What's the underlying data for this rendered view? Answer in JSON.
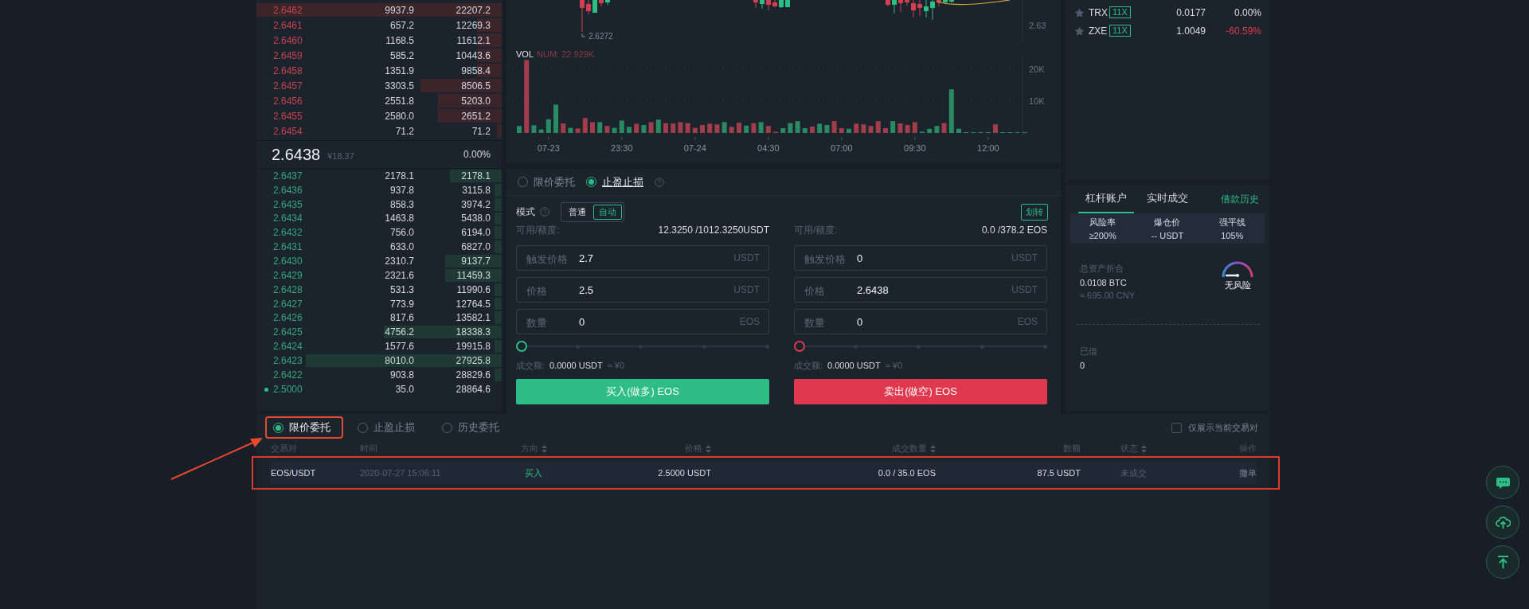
{
  "order_book": {
    "asks": [
      {
        "price": "2.6462",
        "amount": "9937.9",
        "total": "22207.2",
        "level": 1.0
      },
      {
        "price": "2.6461",
        "amount": "657.2",
        "total": "12269.3",
        "level": 0.1
      },
      {
        "price": "2.6460",
        "amount": "1168.5",
        "total": "11612.1",
        "level": 0.1
      },
      {
        "price": "2.6459",
        "amount": "585.2",
        "total": "10443.6",
        "level": 0.1
      },
      {
        "price": "2.6458",
        "amount": "1351.9",
        "total": "9858.4",
        "level": 0.1
      },
      {
        "price": "2.6457",
        "amount": "3303.5",
        "total": "8506.5",
        "level": 0.33
      },
      {
        "price": "2.6456",
        "amount": "2551.8",
        "total": "5203.0",
        "level": 0.26
      },
      {
        "price": "2.6455",
        "amount": "2580.0",
        "total": "2651.2",
        "level": 0.26
      },
      {
        "price": "2.6454",
        "amount": "71.2",
        "total": "71.2",
        "level": 0.02
      }
    ],
    "last": {
      "price": "2.6438",
      "cny": "¥18.37",
      "change": "0.00%"
    },
    "bids": [
      {
        "price": "2.6437",
        "amount": "2178.1",
        "total": "2178.1",
        "level": 0.21,
        "own_order": false
      },
      {
        "price": "2.6436",
        "amount": "937.8",
        "total": "3115.8",
        "level": 0.03,
        "own_order": false
      },
      {
        "price": "2.6435",
        "amount": "858.3",
        "total": "3974.2",
        "level": 0.03,
        "own_order": false
      },
      {
        "price": "2.6434",
        "amount": "1463.8",
        "total": "5438.0",
        "level": 0.03,
        "own_order": false
      },
      {
        "price": "2.6432",
        "amount": "756.0",
        "total": "6194.0",
        "level": 0.03,
        "own_order": false
      },
      {
        "price": "2.6431",
        "amount": "633.0",
        "total": "6827.0",
        "level": 0.03,
        "own_order": false
      },
      {
        "price": "2.6430",
        "amount": "2310.7",
        "total": "9137.7",
        "level": 0.23,
        "own_order": false
      },
      {
        "price": "2.6429",
        "amount": "2321.6",
        "total": "11459.3",
        "level": 0.23,
        "own_order": false
      },
      {
        "price": "2.6428",
        "amount": "531.3",
        "total": "11990.6",
        "level": 0.03,
        "own_order": false
      },
      {
        "price": "2.6427",
        "amount": "773.9",
        "total": "12764.5",
        "level": 0.03,
        "own_order": false
      },
      {
        "price": "2.6426",
        "amount": "817.6",
        "total": "13582.1",
        "level": 0.03,
        "own_order": false
      },
      {
        "price": "2.6425",
        "amount": "4756.2",
        "total": "18338.3",
        "level": 0.48,
        "own_order": false
      },
      {
        "price": "2.6424",
        "amount": "1577.6",
        "total": "19915.8",
        "level": 0.03,
        "own_order": false
      },
      {
        "price": "2.6423",
        "amount": "8010.0",
        "total": "27925.8",
        "level": 0.8,
        "own_order": false
      },
      {
        "price": "2.6422",
        "amount": "903.8",
        "total": "28829.6",
        "level": 0.03,
        "own_order": false
      },
      {
        "price": "2.5000",
        "amount": "35.0",
        "total": "28864.6",
        "level": 0,
        "own_order": true
      }
    ]
  },
  "chart": {
    "low_marker": "2.6272",
    "price_ticks": [
      "2.63"
    ],
    "volume_reading": "NUM: 22.929K",
    "chart_data": {
      "type": "bar",
      "title": "VOL",
      "stacked": true,
      "ylim": [
        0,
        24.5
      ],
      "yticks": [
        {
          "value": 10,
          "label": "10K"
        },
        {
          "value": 20,
          "label": "20K"
        }
      ],
      "categories": [
        null,
        null,
        null,
        null,
        "07-23",
        null,
        null,
        null,
        null,
        null,
        null,
        null,
        null,
        null,
        "23:30",
        null,
        null,
        null,
        null,
        null,
        null,
        null,
        null,
        null,
        "07-24",
        null,
        null,
        null,
        null,
        null,
        null,
        null,
        null,
        null,
        "04:30",
        null,
        null,
        null,
        null,
        null,
        null,
        null,
        null,
        null,
        "07:00",
        null,
        null,
        null,
        null,
        null,
        null,
        null,
        null,
        null,
        "09:30",
        null,
        null,
        null,
        null,
        null,
        null,
        null,
        null,
        null,
        "12:00",
        null,
        null,
        null,
        null,
        null
      ],
      "series": [
        {
          "color": "#2a8a64",
          "values": [
            2.2,
            null,
            2.4,
            1.1,
            4.3,
            8.9,
            null,
            1.6,
            null,
            null,
            null,
            3.4,
            null,
            1.6,
            3.9,
            1.9,
            null,
            2.5,
            null,
            4.2,
            null,
            null,
            null,
            null,
            null,
            null,
            null,
            null,
            3.4,
            null,
            null,
            2.3,
            null,
            3.4,
            null,
            null,
            1.5,
            3.1,
            3.7,
            1.5,
            null,
            2.9,
            2.5,
            null,
            null,
            1.3,
            null,
            null,
            null,
            null,
            null,
            3.7,
            null,
            null,
            null,
            0.4,
            1.3,
            2.2,
            null,
            13.7,
            1.3,
            0,
            0,
            0,
            0,
            null,
            0,
            0,
            0,
            0
          ]
        },
        {
          "color": "#a23d4a",
          "values": [
            null,
            22.9,
            null,
            null,
            null,
            null,
            3.0,
            null,
            1.4,
            4.7,
            3.4,
            null,
            2.2,
            null,
            null,
            null,
            2.9,
            null,
            3.4,
            null,
            3.1,
            3.0,
            3.4,
            3.1,
            1.6,
            2.5,
            2.9,
            2.7,
            null,
            1.9,
            3.2,
            null,
            3.1,
            null,
            2.2,
            0.4,
            null,
            null,
            null,
            null,
            2.0,
            null,
            null,
            3.7,
            1.5,
            null,
            2.9,
            2.7,
            2.2,
            3.7,
            1.5,
            null,
            3.0,
            2.5,
            3.4,
            null,
            null,
            null,
            3.1,
            null,
            null,
            null,
            null,
            null,
            null,
            2.7,
            null,
            null,
            null,
            null
          ]
        }
      ]
    }
  },
  "order_form": {
    "tabs": [
      {
        "label": "限价委托",
        "selected": false
      },
      {
        "label": "止盈止损",
        "selected": true
      }
    ],
    "mode": {
      "label": "模式",
      "options": [
        {
          "label": "普通",
          "selected": false
        },
        {
          "label": "自动",
          "selected": true
        }
      ]
    },
    "transfer_button": "划转",
    "sides": [
      {
        "kind": "buy",
        "available_label": "可用/额度:",
        "available": "12.3250 /1012.3250USDT",
        "fields": [
          {
            "label": "触发价格",
            "value": "2.7",
            "unit": "USDT"
          },
          {
            "label": "价格",
            "value": "2.5",
            "unit": "USDT"
          },
          {
            "label": "数量",
            "value": "0",
            "unit": "EOS"
          }
        ],
        "slider": {
          "level": 0
        },
        "turnover_label": "成交额:",
        "turnover": "0.0000 USDT",
        "turnover_cny": "≈ ¥0",
        "button": "买入(做多) EOS"
      },
      {
        "kind": "sell",
        "available_label": "可用/额度:",
        "available": "0.0 /378.2 EOS",
        "fields": [
          {
            "label": "触发价格",
            "value": "0",
            "unit": "USDT"
          },
          {
            "label": "价格",
            "value": "2.6438",
            "unit": "USDT"
          },
          {
            "label": "数量",
            "value": "0",
            "unit": "EOS"
          }
        ],
        "slider": {
          "level": 0
        },
        "turnover_label": "成交额:",
        "turnover": "0.0000 USDT",
        "turnover_cny": "≈ ¥0",
        "button": "卖出(做空) EOS"
      }
    ]
  },
  "markets": [
    {
      "symbol": "TRX",
      "leverage": "11X",
      "price": "0.0177",
      "change": "0.00%",
      "color": "#d7dde4",
      "favorite": false
    },
    {
      "symbol": "ZXE",
      "leverage": "11X",
      "price": "1.0049",
      "change": "-60.59%",
      "color": "#e0394f",
      "favorite": false
    }
  ],
  "account": {
    "tabs": [
      {
        "label": "杠杆账户",
        "selected": true
      },
      {
        "label": "实时成交",
        "selected": false
      }
    ],
    "history_link": "借款历史",
    "stats": [
      {
        "label": "风险率",
        "value": "≥200%"
      },
      {
        "label": "爆仓价",
        "value": "-- USDT"
      },
      {
        "label": "强平线",
        "value": "105%"
      }
    ],
    "total_label": "总资产折合",
    "total": "0.0108 BTC",
    "total_cny": "≈ 695.00 CNY",
    "risk": {
      "label": "无风险"
    },
    "borrowed_label": "已借",
    "borrowed": "0"
  },
  "orders": {
    "tabs": [
      {
        "label": "限价委托",
        "selected": true,
        "highlighted": true
      },
      {
        "label": "止盈止损",
        "selected": false,
        "highlighted": false
      },
      {
        "label": "历史委托",
        "selected": false,
        "highlighted": false
      }
    ],
    "filter": {
      "label": "仅展示当前交易对",
      "checked": false
    },
    "columns": [
      {
        "label": "交易对",
        "sortable": false
      },
      {
        "label": "时间",
        "sortable": false
      },
      {
        "label": "方向",
        "sortable": true
      },
      {
        "label": "价格",
        "sortable": true
      },
      {
        "label": "成交数量",
        "sortable": true
      },
      {
        "label": "数额",
        "sortable": false
      },
      {
        "label": "状态",
        "sortable": true
      },
      {
        "label": "操作",
        "sortable": false
      }
    ],
    "rows": [
      {
        "highlighted": true,
        "color": "#2ebd85",
        "cells": [
          "EOS/USDT",
          "2020-07-27 15:06:11",
          "买入",
          "2.5000 USDT",
          "0.0 / 35.0 EOS",
          "87.5 USDT",
          "未成交"
        ],
        "action": "撤单"
      }
    ]
  },
  "float_buttons": [
    {
      "kind": "chat"
    },
    {
      "kind": "upload"
    },
    {
      "kind": "top"
    }
  ]
}
